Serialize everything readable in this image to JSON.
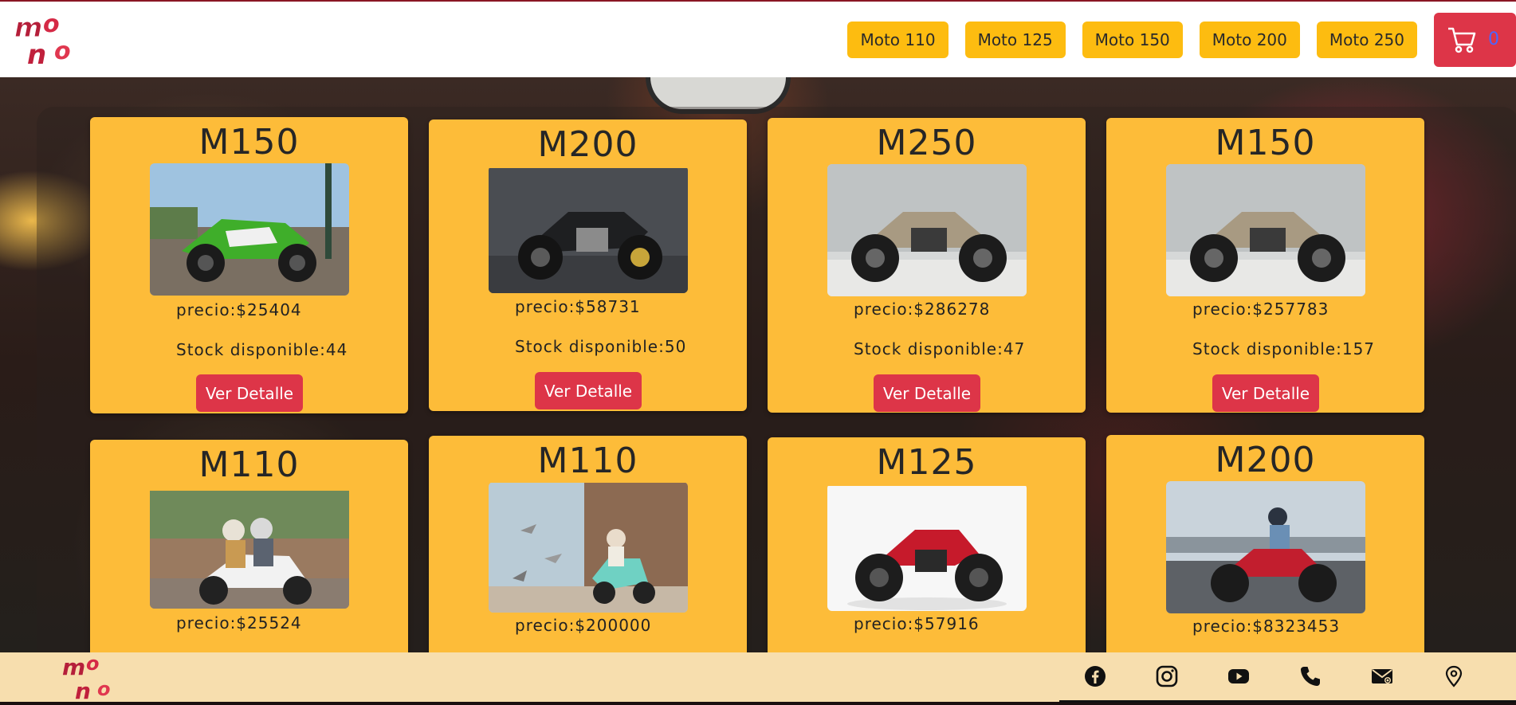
{
  "brand": {
    "logo_text": "MoNo"
  },
  "nav": {
    "items": [
      {
        "label": "Moto 110"
      },
      {
        "label": "Moto 125"
      },
      {
        "label": "Moto 150"
      },
      {
        "label": "Moto 200"
      },
      {
        "label": "Moto 250"
      }
    ],
    "cart": {
      "icon": "cart-icon",
      "count": "0"
    }
  },
  "products": [
    {
      "title": "M150",
      "price": "precio:$25404",
      "stock": "Stock disponible:44",
      "button": "Ver Detalle",
      "image": "green-sport-bike"
    },
    {
      "title": "M200",
      "price": "precio:$58731",
      "stock": "Stock disponible:50",
      "button": "Ver Detalle",
      "image": "black-cafe-racer"
    },
    {
      "title": "M250",
      "price": "precio:$286278",
      "stock": "Stock disponible:47",
      "button": "Ver Detalle",
      "image": "tan-scrambler"
    },
    {
      "title": "M150",
      "price": "precio:$257783",
      "stock": "Stock disponible:157",
      "button": "Ver Detalle",
      "image": "tan-scrambler"
    },
    {
      "title": "M110",
      "price": "precio:$25524",
      "image": "scooter-couple"
    },
    {
      "title": "M110",
      "price": "precio:$200000",
      "image": "vespa-pigeons"
    },
    {
      "title": "M125",
      "price": "precio:$57916",
      "image": "red-naked-bike"
    },
    {
      "title": "M200",
      "price": "precio:$8323453",
      "image": "rider-red-bike"
    }
  ],
  "footer": {
    "socials": [
      {
        "icon": "facebook-icon"
      },
      {
        "icon": "instagram-icon"
      },
      {
        "icon": "youtube-icon"
      },
      {
        "icon": "phone-icon"
      },
      {
        "icon": "mail-icon"
      },
      {
        "icon": "location-pin-icon"
      }
    ]
  },
  "colors": {
    "nav_button": "#fdbc10",
    "card": "#fdbc39",
    "accent_red": "#dd3548",
    "footer": "#f7deae"
  }
}
